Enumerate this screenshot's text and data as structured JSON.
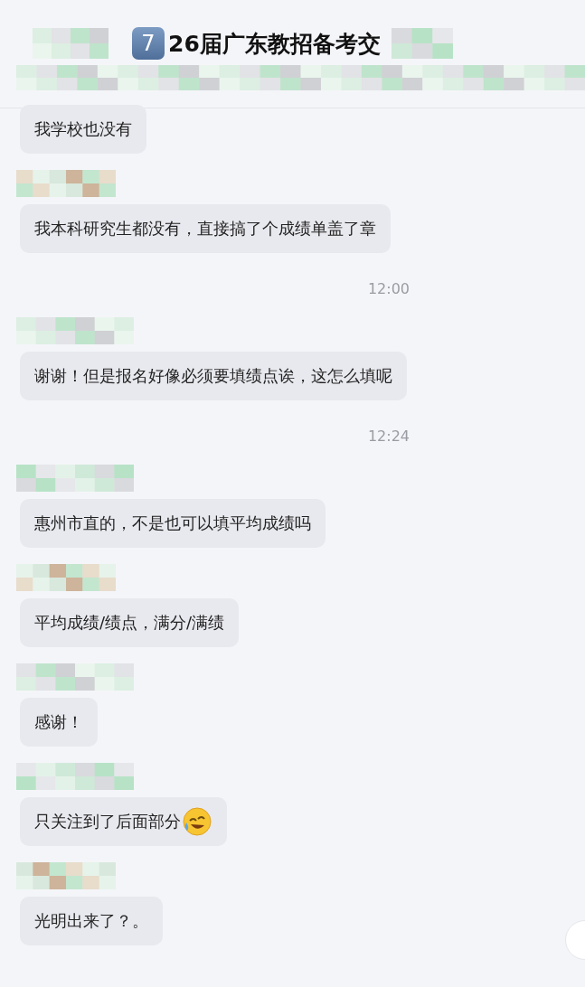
{
  "header": {
    "badge": "7",
    "title": "26届广东教招备考交"
  },
  "messages": [
    {
      "kind": "message",
      "show_sender": false,
      "text": "我学校也没有"
    },
    {
      "kind": "message",
      "show_sender": true,
      "text": "我本科研究生都没有，直接搞了个成绩单盖了章"
    },
    {
      "kind": "time",
      "text": "12:00"
    },
    {
      "kind": "message",
      "show_sender": true,
      "text": "谢谢！但是报名好像必须要填绩点诶，这怎么填呢"
    },
    {
      "kind": "time",
      "text": "12:24"
    },
    {
      "kind": "message",
      "show_sender": true,
      "text": "惠州市直的，不是也可以填平均成绩吗"
    },
    {
      "kind": "message",
      "show_sender": true,
      "text": "平均成绩/绩点，满分/满绩"
    },
    {
      "kind": "message",
      "show_sender": true,
      "text": "感谢！"
    },
    {
      "kind": "message",
      "show_sender": true,
      "text": "只关注到了后面部分",
      "emoji": true
    },
    {
      "kind": "message",
      "show_sender": true,
      "text": "光明出来了？。"
    }
  ]
}
